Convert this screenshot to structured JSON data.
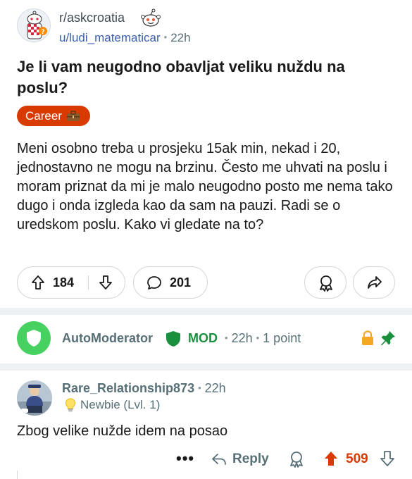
{
  "post": {
    "subreddit": "r/askcroatia",
    "author": "u/ludi_matematicar",
    "age": "22h",
    "title": "Je li vam neugodno obavljat veliku nuždu na poslu?",
    "flair": "Career",
    "body": "Meni osobno treba u prosjeku 15ak min, nekad i 20, jednostavno ne mogu na brzinu. Često me uhvati na poslu i moram priznat da mi je malo neugodno posto me nema tako dugo i onda izgleda kao da sam na pauzi. Radi se o uredskom poslu. Kako vi gledate na to?",
    "upvotes": "184",
    "comments": "201"
  },
  "automod": {
    "name": "AutoModerator",
    "badge": "MOD",
    "age": "22h",
    "points": "1 point"
  },
  "comment": {
    "author": "Rare_Relationship873",
    "age": "22h",
    "user_flair": "Newbie (Lvl. 1)",
    "text": "Zbog velike nužde idem na posao",
    "more": "•••",
    "reply_label": "Reply",
    "score": "509"
  },
  "colors": {
    "flair": "#d93a00",
    "upvoted": "#d93a00",
    "mod_green": "#1a8f3e",
    "automod_avatar": "#46d160",
    "lock": "#f5a623",
    "pin": "#1a8f3e"
  },
  "icons": [
    "upvote-icon",
    "downvote-icon",
    "comment-icon",
    "award-icon",
    "share-icon",
    "shield-icon",
    "lock-icon",
    "pin-icon",
    "reply-icon",
    "lightbulb-icon",
    "briefcase-icon"
  ]
}
